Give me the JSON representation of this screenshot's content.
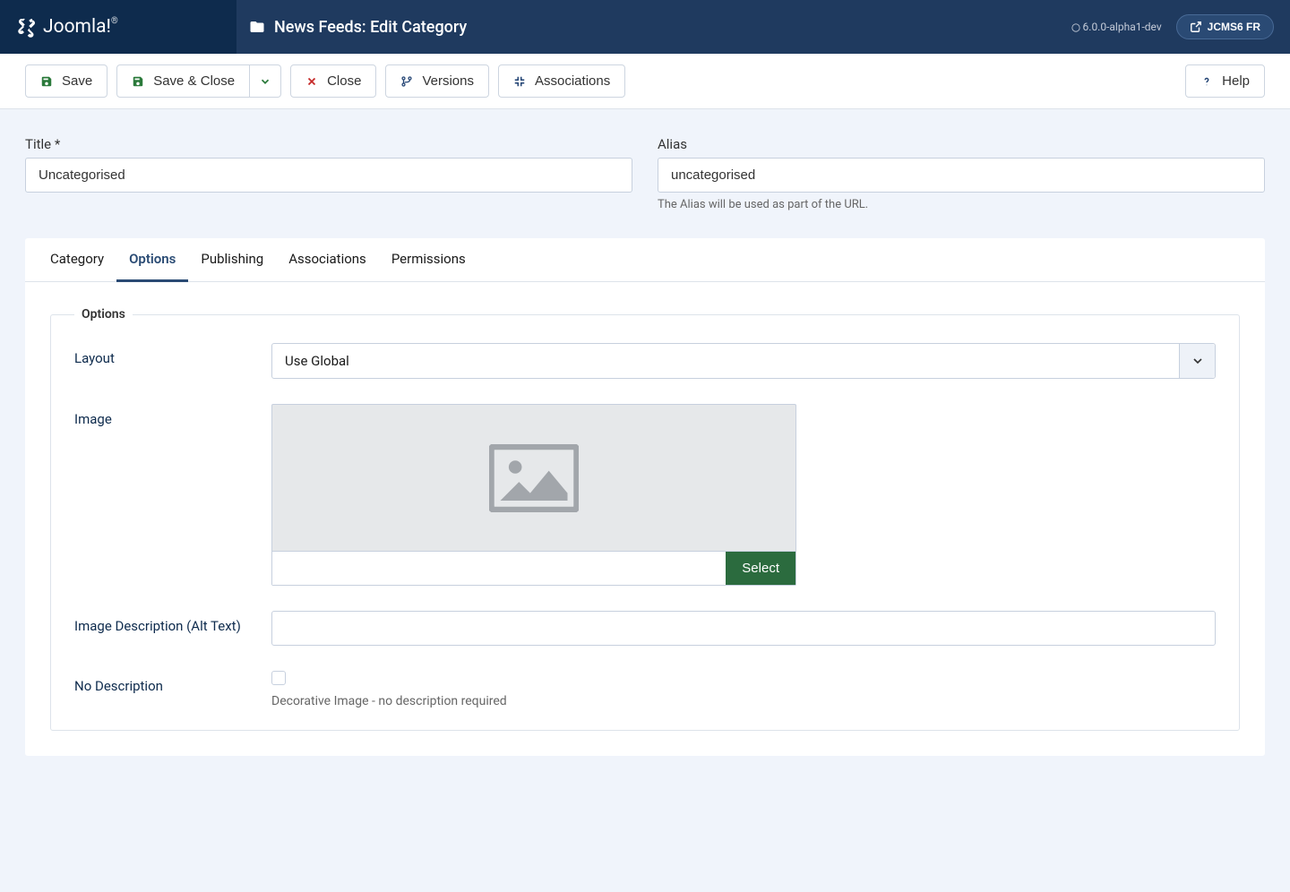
{
  "header": {
    "brand": "Joomla!",
    "title": "News Feeds: Edit Category",
    "version": "6.0.0-alpha1-dev",
    "site": "JCMS6 FR"
  },
  "toolbar": {
    "save": "Save",
    "saveClose": "Save & Close",
    "close": "Close",
    "versions": "Versions",
    "associations": "Associations",
    "help": "Help"
  },
  "fields": {
    "titleLabel": "Title *",
    "titleValue": "Uncategorised",
    "aliasLabel": "Alias",
    "aliasValue": "uncategorised",
    "aliasHint": "The Alias will be used as part of the URL."
  },
  "tabs": [
    "Category",
    "Options",
    "Publishing",
    "Associations",
    "Permissions"
  ],
  "options": {
    "legend": "Options",
    "layoutLabel": "Layout",
    "layoutValue": "Use Global",
    "imageLabel": "Image",
    "imageSelect": "Select",
    "imagePath": "",
    "altLabel": "Image Description (Alt Text)",
    "altValue": "",
    "noDescLabel": "No Description",
    "noDescHint": "Decorative Image - no description required"
  }
}
